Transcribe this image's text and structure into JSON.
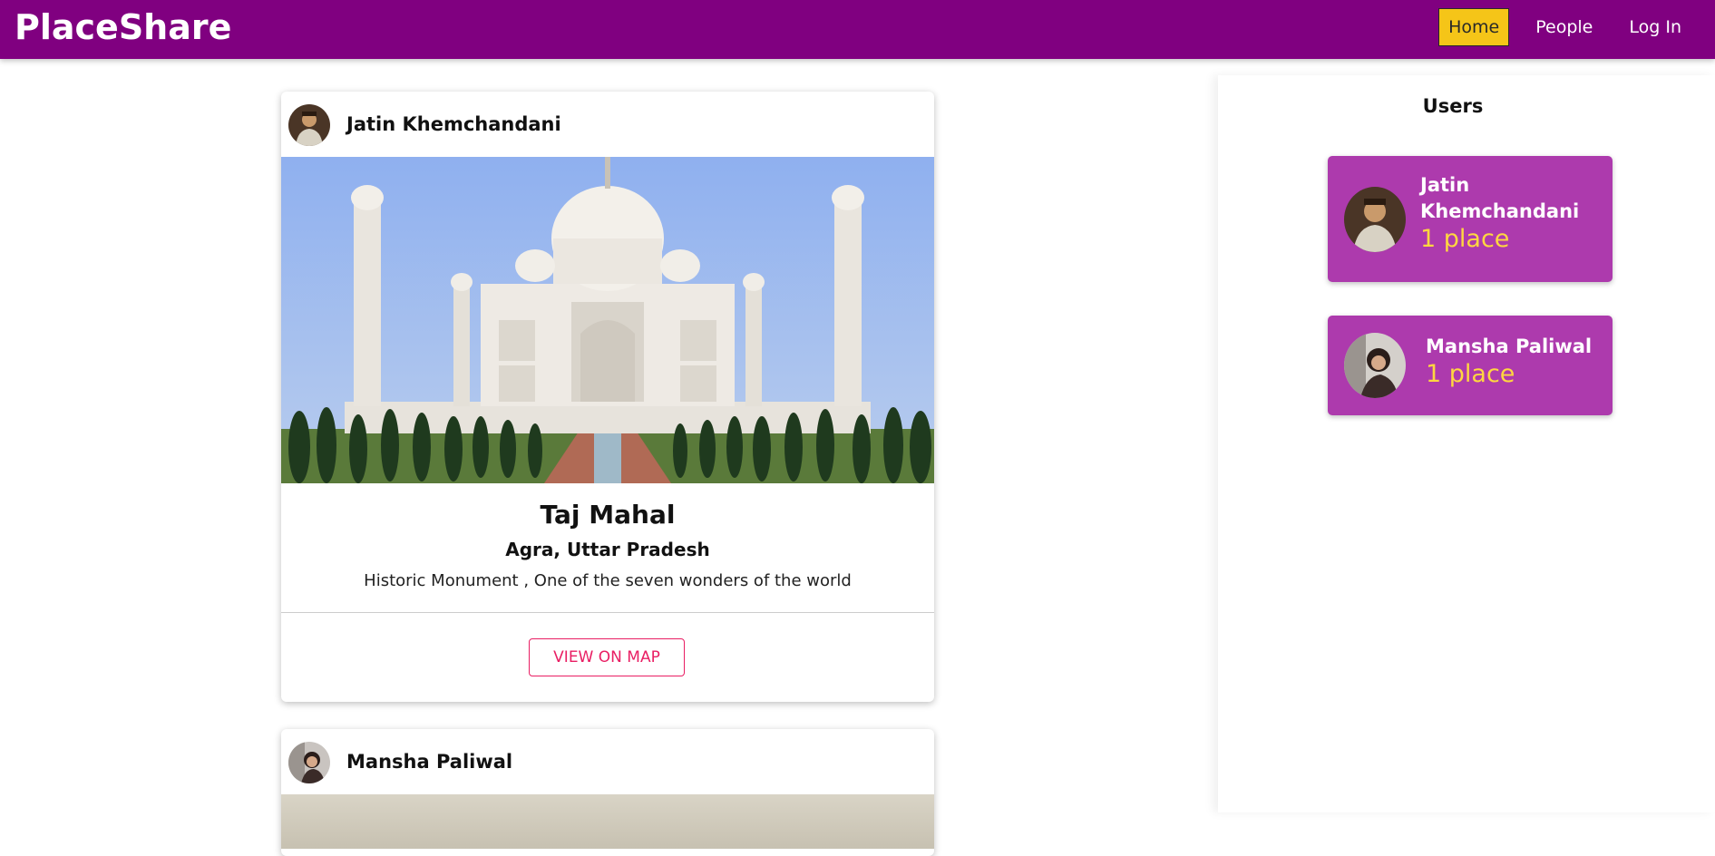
{
  "header": {
    "logo": "PlaceShare",
    "nav": [
      {
        "label": "Home",
        "active": true
      },
      {
        "label": "People",
        "active": false
      },
      {
        "label": "Log In",
        "active": false
      }
    ],
    "brand_color": "#800080",
    "active_color": "#f5c518"
  },
  "feed": {
    "posts": [
      {
        "user": "Jatin Khemchandani",
        "title": "Taj Mahal",
        "address": "Agra, Uttar Pradesh",
        "description": "Historic Monument , One of the seven wonders of the world",
        "action": "VIEW ON MAP"
      },
      {
        "user": "Mansha Paliwal"
      }
    ]
  },
  "sidebar": {
    "title": "Users",
    "users": [
      {
        "name": "Jatin Khemchandani",
        "places": "1 place"
      },
      {
        "name": "Mansha Paliwal",
        "places": "1 place"
      }
    ],
    "card_color": "#ad3aad",
    "count_color": "#ffd740"
  }
}
